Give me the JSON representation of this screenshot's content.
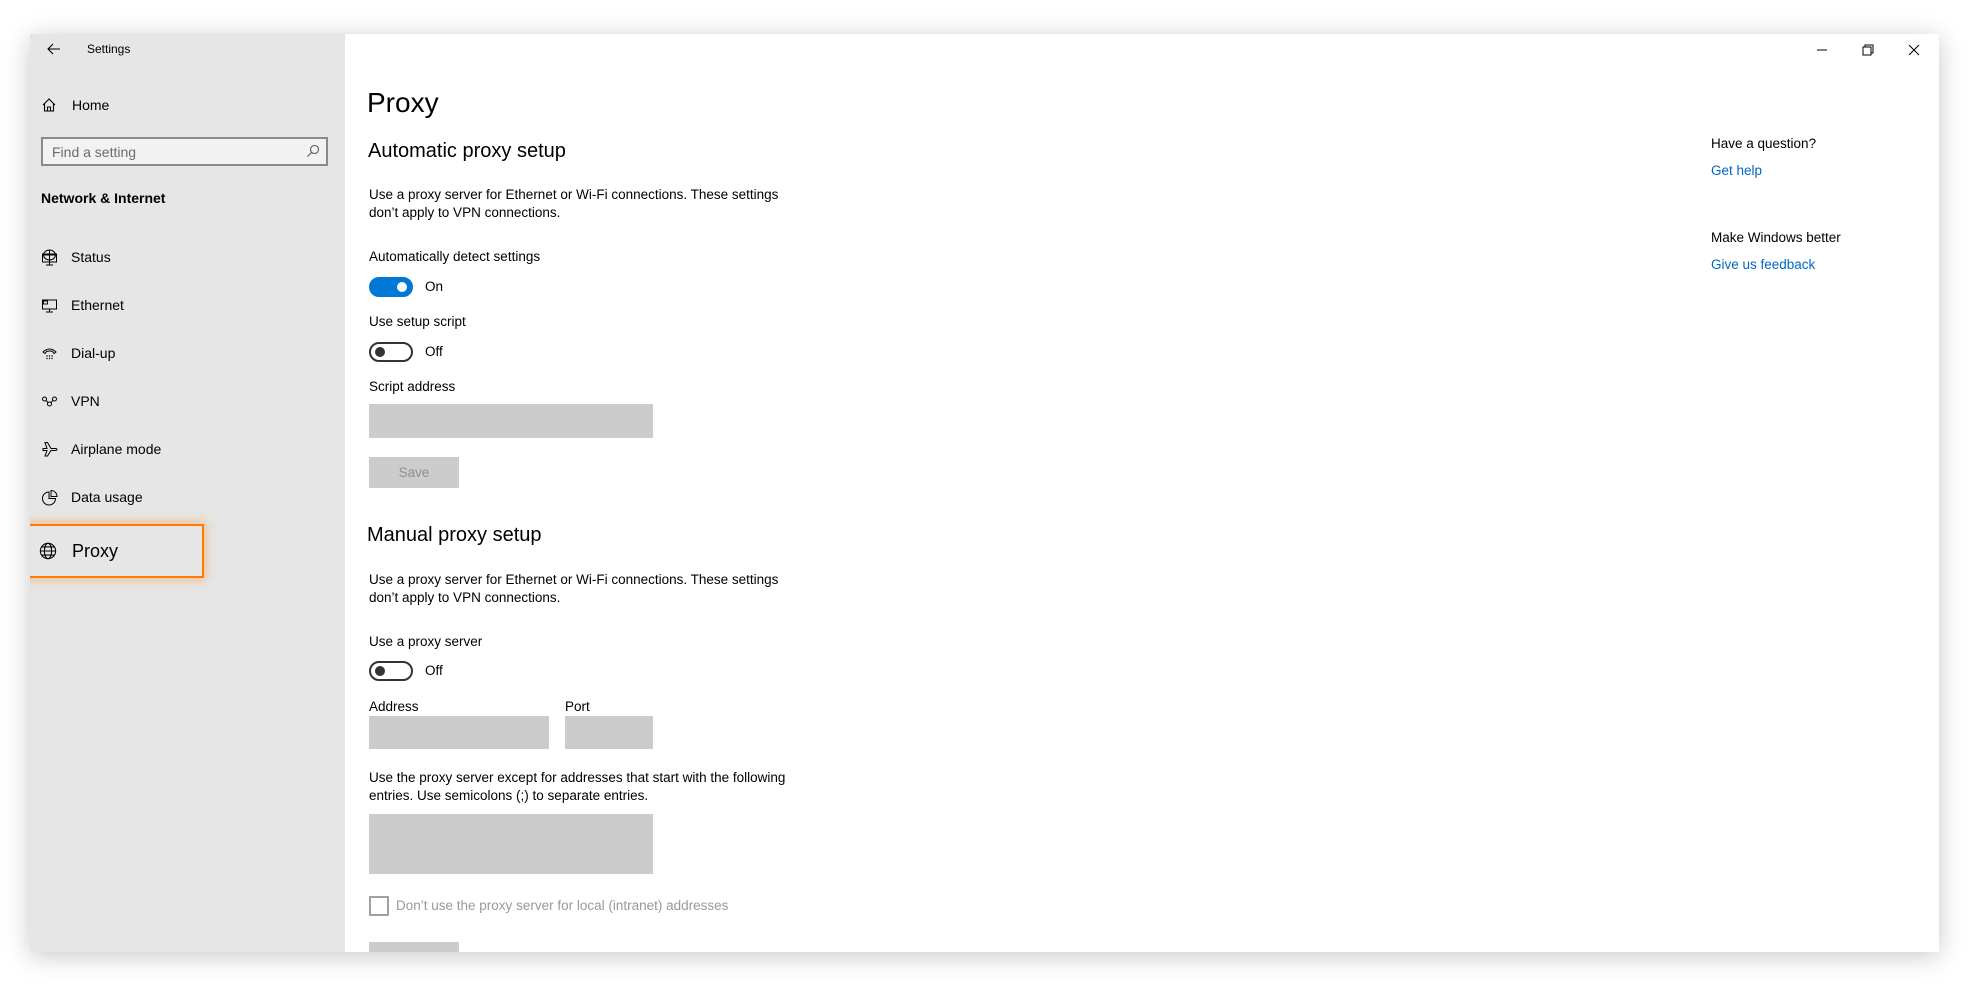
{
  "window": {
    "title": "Settings",
    "controls": [
      "minimize",
      "restore",
      "close"
    ]
  },
  "sidebar": {
    "home_label": "Home",
    "search": {
      "placeholder": "Find a setting",
      "value": ""
    },
    "section_title": "Network & Internet",
    "items": [
      {
        "label": "Status",
        "icon": "globe-monitor-icon"
      },
      {
        "label": "Ethernet",
        "icon": "ethernet-monitor-icon"
      },
      {
        "label": "Dial-up",
        "icon": "telephone-icon"
      },
      {
        "label": "VPN",
        "icon": "vpn-link-icon"
      },
      {
        "label": "Airplane mode",
        "icon": "airplane-icon"
      },
      {
        "label": "Data usage",
        "icon": "pie-chart-icon"
      },
      {
        "label": "Proxy",
        "icon": "globe-icon",
        "selected": true
      }
    ],
    "highlight_color": "#FF7A00"
  },
  "main": {
    "page_title": "Proxy",
    "automatic": {
      "heading": "Automatic proxy setup",
      "description": "Use a proxy server for Ethernet or Wi-Fi connections. These settings don’t apply to VPN connections.",
      "auto_detect": {
        "label": "Automatically detect settings",
        "state": "On",
        "on": true
      },
      "setup_script": {
        "label": "Use setup script",
        "state": "Off",
        "on": false
      },
      "script_address": {
        "label": "Script address",
        "value": ""
      },
      "save_label": "Save"
    },
    "manual": {
      "heading": "Manual proxy setup",
      "description": "Use a proxy server for Ethernet or Wi-Fi connections. These settings don’t apply to VPN connections.",
      "use_proxy": {
        "label": "Use a proxy server",
        "state": "Off",
        "on": false
      },
      "address": {
        "label": "Address",
        "value": ""
      },
      "port": {
        "label": "Port",
        "value": ""
      },
      "exceptions": {
        "description": "Use the proxy server except for addresses that start with the following entries. Use semicolons (;) to separate entries.",
        "value": ""
      },
      "local_bypass": {
        "label": "Don’t use the proxy server for local (intranet) addresses",
        "checked": false
      }
    }
  },
  "related": {
    "question_heading": "Have a question?",
    "get_help": "Get help",
    "feedback_heading": "Make Windows better",
    "give_feedback": "Give us feedback"
  },
  "colors": {
    "accent": "#0078D7",
    "link": "#0067C0",
    "sidebar_bg": "#E6E6E6",
    "disabled_field": "#CCCCCC"
  }
}
